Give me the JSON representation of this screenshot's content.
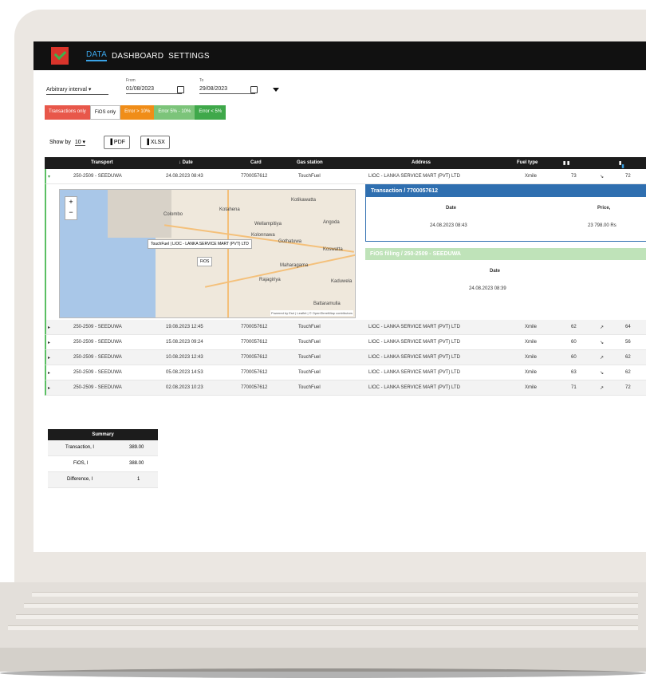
{
  "nav": {
    "items": [
      "DATA",
      "DASHBOARD",
      "SETTINGS"
    ],
    "active": "DATA"
  },
  "filters": {
    "interval": "Arbitrary interval",
    "from_label": "From",
    "from": "01/08/2023",
    "to_label": "To",
    "to": "29/08/2023"
  },
  "chips": [
    "Transactions only",
    "FiOS only",
    "Error > 10%",
    "Error 5% - 10%",
    "Error < 5%"
  ],
  "toolbar": {
    "show_by_label": "Show by",
    "show_by_value": "10",
    "pdf": "PDF",
    "xlsx": "XLSX"
  },
  "table": {
    "columns": [
      "Transport",
      "↓ Date",
      "Card",
      "Gas station",
      "Address",
      "Fuel type"
    ],
    "rows": [
      {
        "transport": "250-2509 - SEEDUWA",
        "date": "24.08.2023 08:43",
        "card": "7700057612",
        "station": "TouchFuel",
        "address": "LIOC - LANKA SERVICE MART (PVT) LTD",
        "fuel": "Xmile",
        "v1": "73",
        "v2": "72"
      },
      {
        "transport": "250-2509 - SEEDUWA",
        "date": "19.08.2023 12:45",
        "card": "7700057612",
        "station": "TouchFuel",
        "address": "LIOC - LANKA SERVICE MART (PVT) LTD",
        "fuel": "Xmile",
        "v1": "62",
        "v2": "64"
      },
      {
        "transport": "250-2509 - SEEDUWA",
        "date": "15.08.2023 09:24",
        "card": "7700057612",
        "station": "TouchFuel",
        "address": "LIOC - LANKA SERVICE MART (PVT) LTD",
        "fuel": "Xmile",
        "v1": "60",
        "v2": "56"
      },
      {
        "transport": "250-2509 - SEEDUWA",
        "date": "10.08.2023 12:43",
        "card": "7700057612",
        "station": "TouchFuel",
        "address": "LIOC - LANKA SERVICE MART (PVT) LTD",
        "fuel": "Xmile",
        "v1": "60",
        "v2": "62"
      },
      {
        "transport": "250-2509 - SEEDUWA",
        "date": "05.08.2023 14:53",
        "card": "7700057612",
        "station": "TouchFuel",
        "address": "LIOC - LANKA SERVICE MART (PVT) LTD",
        "fuel": "Xmile",
        "v1": "63",
        "v2": "62"
      },
      {
        "transport": "250-2509 - SEEDUWA",
        "date": "02.08.2023 10:23",
        "card": "7700057612",
        "station": "TouchFuel",
        "address": "LIOC - LANKA SERVICE MART (PVT) LTD",
        "fuel": "Xmile",
        "v1": "71",
        "v2": "72"
      }
    ]
  },
  "map": {
    "tooltip": "TouchFuel | LIOC - LANKA SERVICE MART (PVT) LTD",
    "marker": "FiOS",
    "places": [
      "Colombo",
      "Kotahena",
      "Wellampitiya",
      "Kolonnawa",
      "Kotikawatta",
      "Angoda",
      "Gothatuwa",
      "Maharagama",
      "Battaramulla",
      "Rajagiriya",
      "Koswatta",
      "Kaduwela"
    ],
    "attribution": "Powered by Esri | Leaflet | © OpenStreetMap contributors"
  },
  "transaction_panel": {
    "title": "Transaction / 7700057612",
    "date_label": "Date",
    "price_label": "Price,",
    "date": "24.08.2023 08:43",
    "price": "23 798.00 Rs"
  },
  "fios_panel": {
    "title": "FiOS filling / 250-2509 - SEEDUWA",
    "date_label": "Date",
    "date": "24.08.2023 08:39"
  },
  "summary": {
    "title": "Summary",
    "rows": [
      {
        "label": "Transaction, l",
        "value": "389.00"
      },
      {
        "label": "FiOS, l",
        "value": "388.00"
      },
      {
        "label": "Difference, l",
        "value": "1"
      }
    ]
  }
}
